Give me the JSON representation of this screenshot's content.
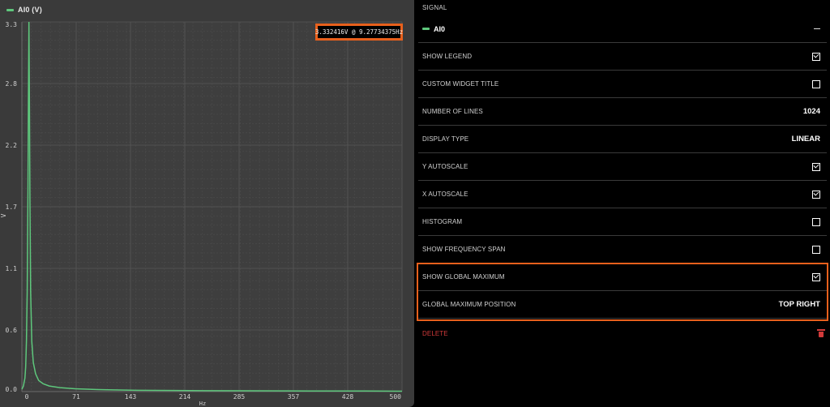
{
  "chart": {
    "legend_label": "AI0 (V)",
    "ylabel": "V",
    "xlabel": "Hz",
    "global_max_text": "3.332416V @ 9.27734375Hz"
  },
  "chart_data": {
    "type": "line",
    "title": "",
    "xlabel": "Hz",
    "ylabel": "V",
    "xlim": [
      0,
      500
    ],
    "ylim": [
      0,
      3.3
    ],
    "x_ticks": [
      "0",
      "71",
      "143",
      "214",
      "285",
      "357",
      "428",
      "500"
    ],
    "y_ticks": [
      "3.3",
      "2.8",
      "2.2",
      "1.7",
      "1.1",
      "0.6",
      "0.0"
    ],
    "grid": true,
    "legend_placement": "top-left",
    "series": [
      {
        "name": "AI0 (V)",
        "color": "#5ec77c",
        "x": [
          0,
          2,
          4,
          5,
          6,
          7,
          8,
          8.6,
          9.28,
          10,
          10.6,
          11.5,
          13,
          15,
          18,
          22,
          28,
          36,
          50,
          70,
          100,
          150,
          200,
          250,
          300,
          350,
          400,
          450,
          500
        ],
        "y": [
          0.02,
          0.05,
          0.12,
          0.22,
          0.45,
          0.9,
          1.8,
          2.6,
          3.332,
          2.5,
          1.7,
          0.9,
          0.45,
          0.26,
          0.16,
          0.1,
          0.07,
          0.05,
          0.035,
          0.025,
          0.018,
          0.012,
          0.01,
          0.008,
          0.007,
          0.006,
          0.005,
          0.005,
          0.004
        ]
      }
    ]
  },
  "settings": {
    "signal_header": "SIGNAL",
    "signal_name": "AI0",
    "show_legend": "SHOW LEGEND",
    "custom_widget_title": "CUSTOM WIDGET TITLE",
    "number_of_lines": "NUMBER OF LINES",
    "number_of_lines_value": "1024",
    "display_type": "DISPLAY TYPE",
    "display_type_value": "LINEAR",
    "y_autoscale": "Y AUTOSCALE",
    "x_autoscale": "X AUTOSCALE",
    "histogram": "HISTOGRAM",
    "show_frequency_span": "SHOW FREQUENCY SPAN",
    "show_global_maximum": "SHOW GLOBAL MAXIMUM",
    "global_maximum_position": "GLOBAL MAXIMUM POSITION",
    "global_maximum_position_value": "TOP RIGHT",
    "delete": "DELETE"
  },
  "checkboxes": {
    "show_legend": true,
    "custom_widget_title": false,
    "y_autoscale": true,
    "x_autoscale": true,
    "histogram": false,
    "show_frequency_span": false,
    "show_global_maximum": true
  },
  "colors": {
    "accent_highlight": "#e8601c",
    "series": "#5ec77c",
    "delete": "#d23a3a"
  }
}
